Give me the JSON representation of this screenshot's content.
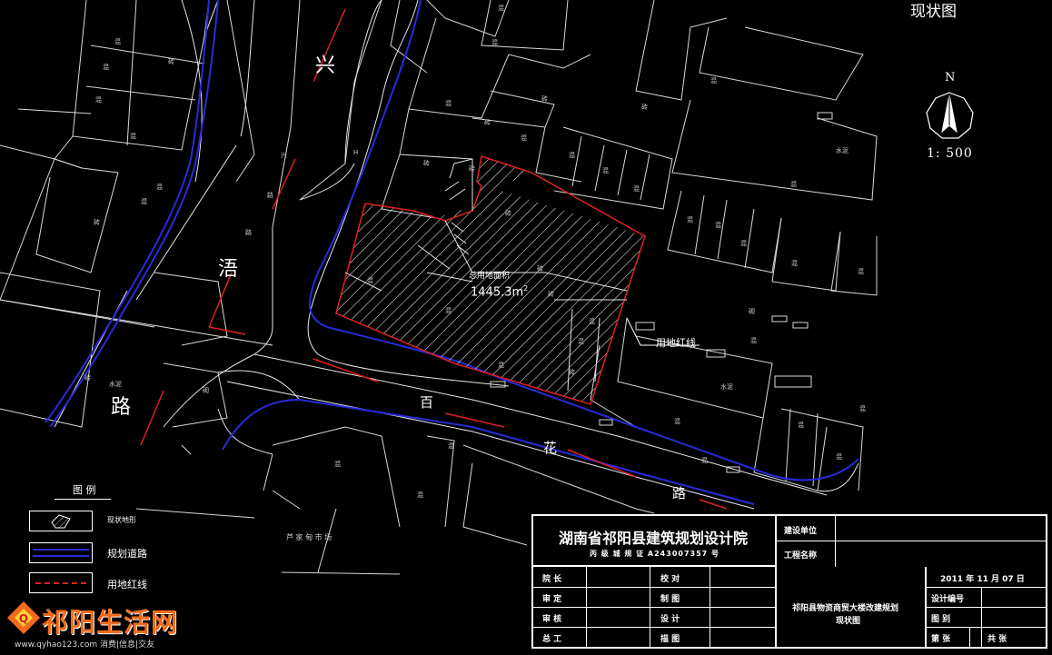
{
  "drawing": {
    "view_title": "现状图",
    "north_label": "N",
    "scale_label": "1:  500"
  },
  "roads": {
    "xing": "兴",
    "wu": "浯",
    "lu_left": "路",
    "bai": "百",
    "hua": "花",
    "lu_bottom": "路"
  },
  "site": {
    "area_title": "总用地面积",
    "area_value": "1445.3m",
    "area_unit_sup": "2",
    "redline_callout": "用地红线"
  },
  "map_labels": {
    "market": "芦家甸市场",
    "small": [
      "混",
      "混",
      "砖",
      "混",
      "混",
      "混",
      "砖",
      "混",
      "混",
      "混",
      "混",
      "水泥",
      "混",
      "砖",
      "混",
      "混",
      "混",
      "混",
      "混",
      "水泥",
      "砖",
      "混",
      "混",
      "混",
      "混",
      "混",
      "混",
      "混",
      "水泥",
      "混",
      "混",
      "混",
      "混",
      "混",
      "混",
      "混",
      "混"
    ]
  },
  "legend": {
    "title": "图   例",
    "items": [
      {
        "label": "现状地形"
      },
      {
        "label": "规划道路"
      },
      {
        "label": "用地红线"
      }
    ],
    "colors": {
      "road_blue": "#2a2ad8",
      "redline": "#e02020",
      "hatch": "#ffffff"
    }
  },
  "title_block": {
    "institute": "湖南省祁阳县建筑规划设计院",
    "certificate": "丙 级 城 规 证  A243007357 号",
    "build_unit_label": "建设单位",
    "project_name_label": "工程名称",
    "left_rows": [
      {
        "a": "院    长",
        "b": "校    对"
      },
      {
        "a": "审    定",
        "b": "制    图"
      },
      {
        "a": "审    核",
        "b": "设    计"
      },
      {
        "a": "总    工",
        "b": "描    图"
      }
    ],
    "project_title_line1": "祁阳县物资商贸大楼改建规划",
    "project_title_line2": "现状图",
    "date": "2011  年    11  月  07   日",
    "right_rows": [
      {
        "label": "设计编号"
      },
      {
        "label": "图        别"
      },
      {
        "label": "第     张",
        "extra": "共     张"
      }
    ]
  },
  "watermark": {
    "brand": "祁阳生活网",
    "url": "www.qyhao123.com 消费|信息|交友"
  }
}
